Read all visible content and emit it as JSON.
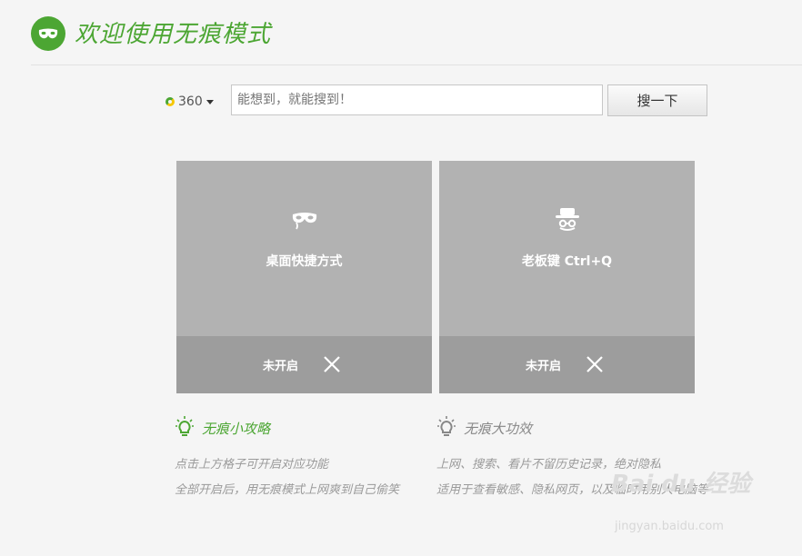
{
  "header": {
    "title": "欢迎使用无痕模式",
    "logo_icon": "mask-icon",
    "accent_color": "#4ca633"
  },
  "search": {
    "engine_label": "360",
    "engine_icon": "360-search-icon",
    "placeholder": "能想到，就能搜到！",
    "button_label": "搜一下"
  },
  "cards": [
    {
      "title": "桌面快捷方式",
      "icon": "mask-icon",
      "status": "未开启",
      "toggle_icon": "close-icon"
    },
    {
      "title": "老板键 Ctrl+Q",
      "icon": "incognito-hat-icon",
      "status": "未开启",
      "toggle_icon": "close-icon"
    }
  ],
  "tips": [
    {
      "heading": "无痕小攻略",
      "icon": "lightbulb-icon",
      "heading_color": "#4ca633",
      "lines": [
        "点击上方格子可开启对应功能",
        "全部开启后，用无痕模式上网爽到自己偷笑"
      ]
    },
    {
      "heading": "无痕大功效",
      "icon": "lightbulb-icon",
      "heading_color": "#888888",
      "lines": [
        "上网、搜索、看片不留历史记录，绝对隐私",
        "适用于查看敏感、隐私网页，以及临时用别人电脑等"
      ]
    }
  ],
  "watermark": {
    "text": "Bai du 经验",
    "url": "jingyan.baidu.com"
  }
}
